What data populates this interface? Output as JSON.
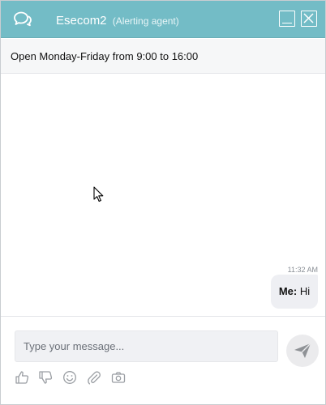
{
  "header": {
    "chat_icon": "chat-bubbles-icon",
    "agent_name": "Esecom2",
    "agent_role": "(Alerting agent)",
    "minimize_icon": "minimize-icon",
    "close_icon": "close-icon",
    "background_color": "#73bcc6"
  },
  "info_bar": {
    "opening_hours": "Open Monday-Friday from 9:00 to 16:00"
  },
  "messages": [
    {
      "time": "11:32 AM",
      "sender": "Me:",
      "text": "Hi"
    }
  ],
  "composer": {
    "placeholder": "Type your message...",
    "value": "",
    "send_icon": "paper-plane-icon",
    "tools": [
      "thumbs-up-icon",
      "thumbs-down-icon",
      "smiley-icon",
      "paperclip-icon",
      "camera-icon"
    ]
  }
}
